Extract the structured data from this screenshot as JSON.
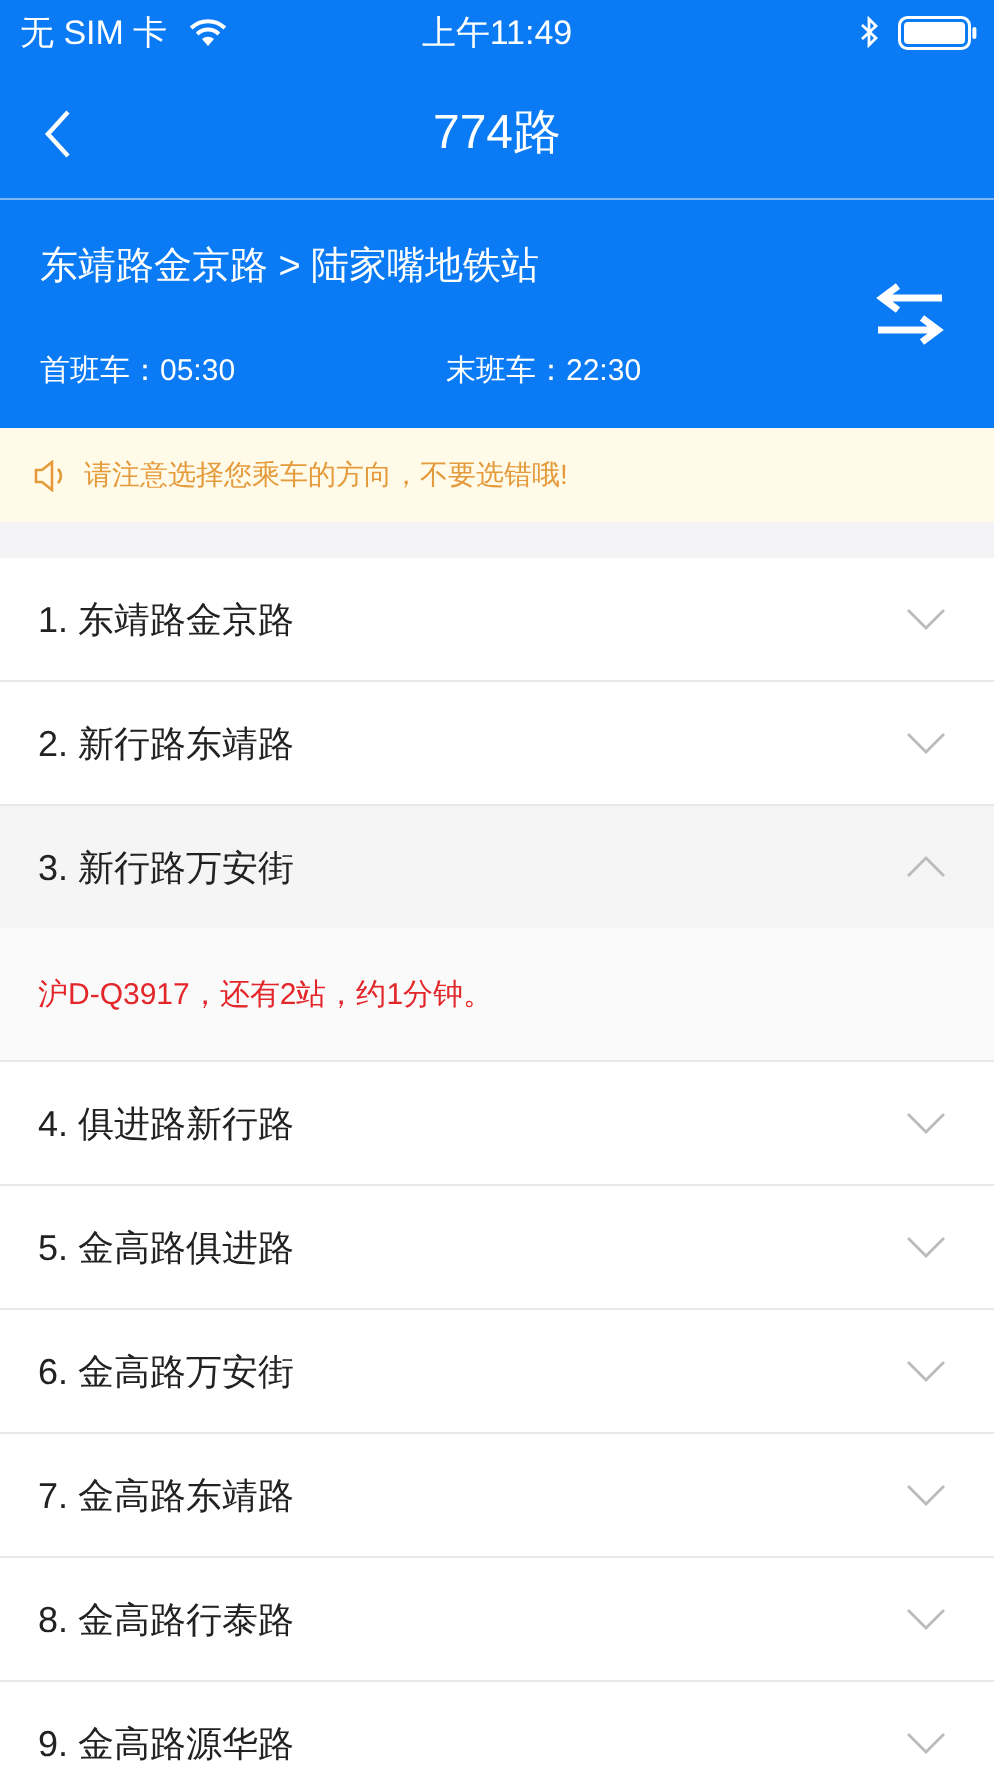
{
  "status_bar": {
    "carrier": "无 SIM 卡",
    "time": "上午11:49"
  },
  "nav": {
    "title": "774路"
  },
  "route": {
    "direction": "东靖路金京路 > 陆家嘴地铁站",
    "first_bus": "首班车：05:30",
    "last_bus": "末班车：22:30"
  },
  "notice": "请注意选择您乘车的方向，不要选错哦!",
  "stops": [
    {
      "name": "1. 东靖路金京路",
      "expanded": false
    },
    {
      "name": "2. 新行路东靖路",
      "expanded": false
    },
    {
      "name": "3. 新行路万安街",
      "expanded": true,
      "detail": "沪D-Q3917，还有2站，约1分钟。"
    },
    {
      "name": "4. 俱进路新行路",
      "expanded": false
    },
    {
      "name": "5. 金高路俱进路",
      "expanded": false
    },
    {
      "name": "6. 金高路万安街",
      "expanded": false
    },
    {
      "name": "7. 金高路东靖路",
      "expanded": false
    },
    {
      "name": "8. 金高路行泰路",
      "expanded": false
    },
    {
      "name": "9. 金高路源华路",
      "expanded": false
    }
  ]
}
